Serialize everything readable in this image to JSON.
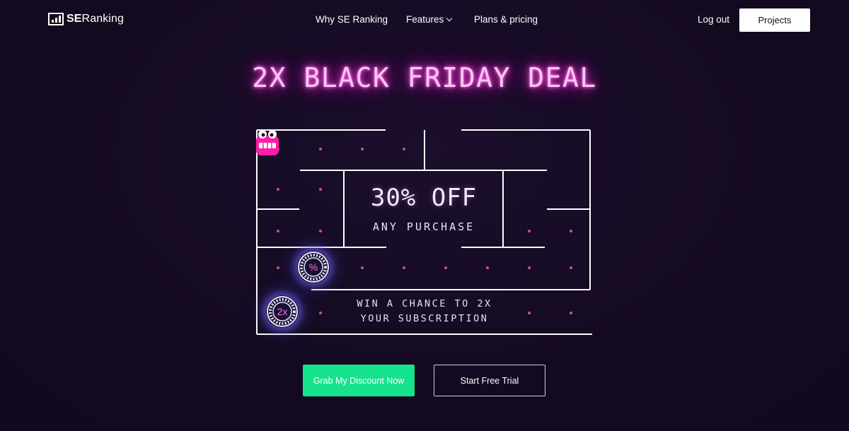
{
  "brand": {
    "logo_bold": "SE",
    "logo_rest": "Ranking"
  },
  "nav": {
    "why": "Why SE Ranking",
    "features": "Features",
    "plans": "Plans & pricing"
  },
  "account": {
    "logout": "Log out",
    "projects": "Projects"
  },
  "hero": {
    "headline": "2X BLACK FRIDAY DEAL",
    "offer_big": "30% OFF",
    "offer_small": "ANY PURCHASE",
    "win_line1": "WIN A CHANCE TO 2X",
    "win_line2": "YOUR SUBSCRIPTION",
    "token_percent": "%",
    "token_2x": "2x"
  },
  "cta": {
    "grab": "Grab My Discount Now",
    "trial": "Start Free Trial"
  },
  "colors": {
    "background": "#150b22",
    "neon_pink": "#ff3fd8",
    "cta_green": "#16e28c",
    "maze_line": "#ffffff",
    "dot": "#c24fa8"
  },
  "icons": {
    "logo": "bar-chart-icon",
    "features_dropdown": "chevron-down-icon",
    "monster": "monster-icon",
    "tokens": "coin-icon"
  }
}
